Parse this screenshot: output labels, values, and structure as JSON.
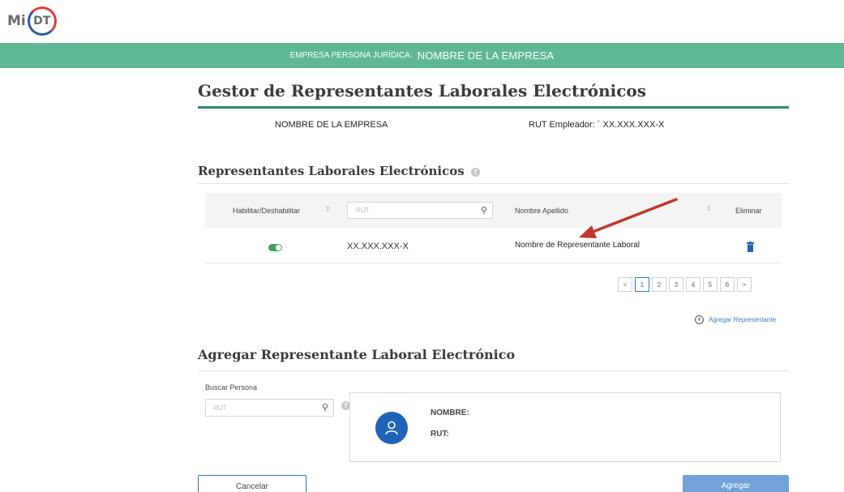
{
  "logo": {
    "prefix": "Mi",
    "badge": "DT"
  },
  "banner": {
    "label": "EMPRESA PERSONA JURÍDICA:",
    "company": "NOMBRE DE LA EMPRESA"
  },
  "page_title": "Gestor de Representantes Laborales Electrónicos",
  "employer": {
    "company_name": "NOMBRE DE LA EMPRESA",
    "rut_line": "RUT Empleador: ´ XX.XXX.XXX-X"
  },
  "list_section": {
    "title": "Representantes Laborales Electrónicos",
    "columns": {
      "enable": "Habilitar/Deshabilitar",
      "rut_placeholder": "RUT",
      "name": "Nombre Apellido",
      "delete": "Eliminar"
    },
    "rows": [
      {
        "enabled": true,
        "rut": "XX.XXX.XXX-X",
        "name": "Nombre de Representante Laboral"
      }
    ],
    "pagination": {
      "prev": "<",
      "pages": [
        "1",
        "2",
        "3",
        "4",
        "5",
        "6"
      ],
      "next": ">",
      "current": "1"
    },
    "add_link": "Agregar Representante"
  },
  "add_section": {
    "title": "Agregar Representante Laboral Electrónico",
    "search_label": "Buscar Persona",
    "search_placeholder": "RUT",
    "card": {
      "name_label": "NOMBRE:",
      "rut_label": "RUT:"
    },
    "cancel_button": "Cancelar",
    "add_button": "Agregar"
  },
  "icons": {
    "search": "magnifier-icon",
    "help": "question-icon",
    "sort": "sort-icon",
    "delete": "trash-icon",
    "avatar": "user-icon",
    "add": "plus-circle-icon"
  },
  "colors": {
    "banner": "#5fb895",
    "title_rule": "#2e8b6a",
    "accent_blue": "#2d73c4",
    "toggle_on": "#3fa35a",
    "annotation_arrow": "#c0392b",
    "add_button": "#72a3d8"
  }
}
